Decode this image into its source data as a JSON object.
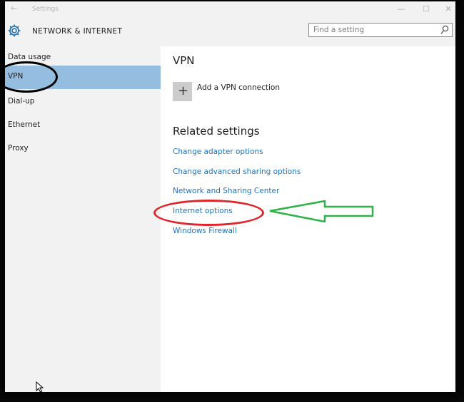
{
  "window": {
    "title": "Settings",
    "back_glyph": "←",
    "controls": {
      "minimize": "—",
      "maximize": "☐",
      "close": "✕"
    }
  },
  "header": {
    "title": "NETWORK & INTERNET",
    "icon": "gear-icon",
    "search_placeholder": "Find a setting",
    "search_value": ""
  },
  "sidebar": {
    "selected": "VPN",
    "items": [
      {
        "label": "Data usage"
      },
      {
        "label": "VPN"
      },
      {
        "label": "Dial-up"
      },
      {
        "label": "Ethernet"
      },
      {
        "label": "Proxy"
      }
    ]
  },
  "main": {
    "section_title": "VPN",
    "add_vpn": {
      "icon": "plus-icon",
      "glyph": "+",
      "label": "Add a VPN connection"
    },
    "related_title": "Related settings",
    "related_links": [
      {
        "label": "Change adapter options"
      },
      {
        "label": "Change advanced sharing options"
      },
      {
        "label": "Network and Sharing Center"
      },
      {
        "label": "Internet options"
      },
      {
        "label": "Windows Firewall"
      }
    ]
  },
  "annotations": {
    "black_oval": "black oval around VPN",
    "red_oval": "red oval around Internet options",
    "green_arrow": "green arrow pointing to Internet options",
    "colors": {
      "black": "#000000",
      "red": "#e0242a",
      "green": "#2fb24a",
      "accent": "#1f73c0",
      "selection": "#95bde0"
    }
  }
}
